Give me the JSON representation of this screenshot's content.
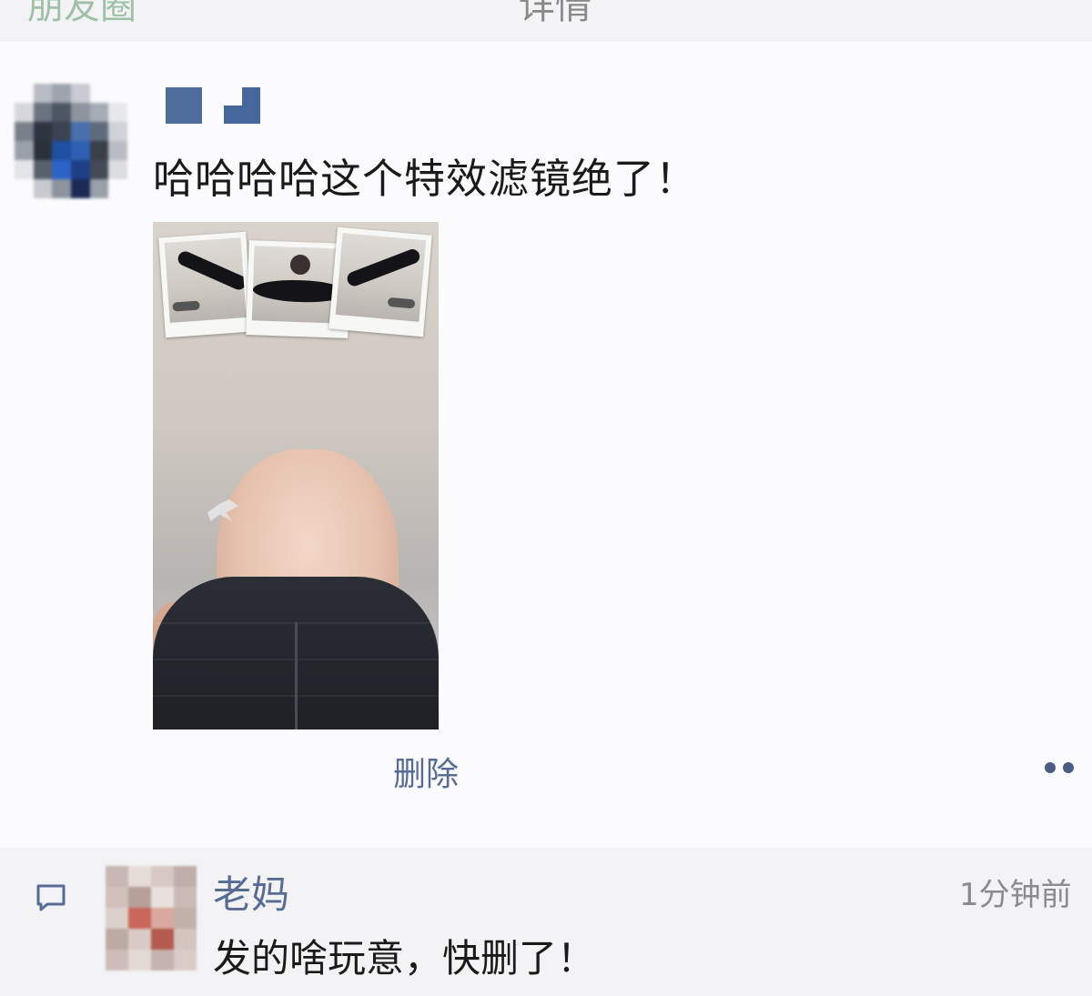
{
  "top_bar": {
    "back_text": "朋友圈",
    "title_text": "详情"
  },
  "post": {
    "text": "哈哈哈哈这个特效滤镜绝了！",
    "photo_alt": "特效照片",
    "delete_label": "删除"
  },
  "comment": {
    "name": "老妈",
    "time": "1分钟前",
    "text": "发的啥玩意，快删了！"
  },
  "colors": {
    "link": "#576b95",
    "comment_bg": "#f3f3f5",
    "text": "#1a1a1a",
    "secondary": "#8a8a8f"
  },
  "icons": {
    "comment": "comment-bubble-icon",
    "more": "more-dots-icon"
  }
}
